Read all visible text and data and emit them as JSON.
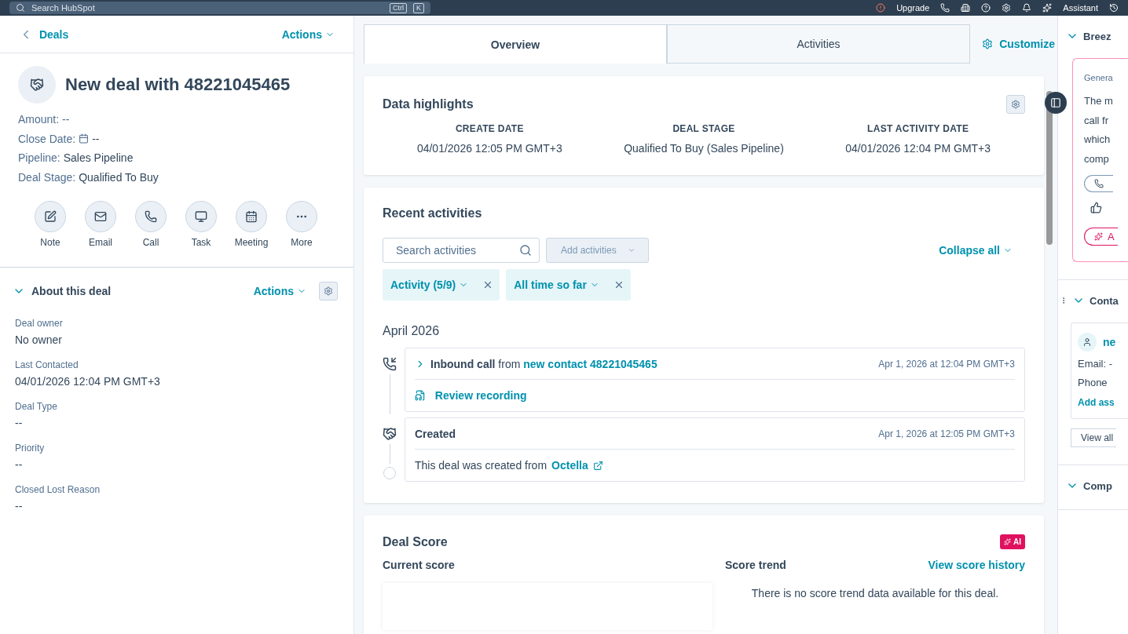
{
  "topbar": {
    "search_placeholder": "Search HubSpot",
    "shortcut_keys": [
      "Ctrl",
      "K"
    ],
    "upgrade": "Upgrade",
    "assistant": "Assistant"
  },
  "left": {
    "back": "Deals",
    "actions": "Actions",
    "title": "New deal with 48221045465",
    "properties": [
      {
        "text": "Amount: --",
        "kind": "text"
      },
      {
        "label": "Close Date:",
        "value": "--",
        "kind": "date"
      },
      {
        "label": "Pipeline:",
        "value": "Sales Pipeline",
        "kind": "field"
      },
      {
        "label": "Deal Stage:",
        "value": "Qualified To Buy",
        "kind": "field"
      }
    ],
    "quick_actions": [
      {
        "label": "Note",
        "kind": "note"
      },
      {
        "label": "Email",
        "kind": "email"
      },
      {
        "label": "Call",
        "kind": "call"
      },
      {
        "label": "Task",
        "kind": "task"
      },
      {
        "label": "Meeting",
        "kind": "meeting"
      },
      {
        "label": "More",
        "kind": "more"
      }
    ],
    "about": {
      "title": "About this deal",
      "actions": "Actions",
      "expanded": true,
      "fields": [
        {
          "label": "Deal owner",
          "value": "No owner"
        },
        {
          "label": "Last Contacted",
          "value": "04/01/2026 12:04 PM GMT+3"
        },
        {
          "label": "Deal Type",
          "value": "--"
        },
        {
          "label": "Priority",
          "value": "--"
        },
        {
          "label": "Closed Lost Reason",
          "value": "--"
        }
      ]
    }
  },
  "middle": {
    "tabs": [
      {
        "label": "Overview",
        "selected": true
      },
      {
        "label": "Activities",
        "selected": false
      }
    ],
    "customize": "Customize",
    "highlights": {
      "title": "Data highlights",
      "columns": [
        {
          "label": "CREATE DATE",
          "value": "04/01/2026 12:05 PM GMT+3"
        },
        {
          "label": "DEAL STAGE",
          "value": "Qualified To Buy (Sales Pipeline)"
        },
        {
          "label": "LAST ACTIVITY DATE",
          "value": "04/01/2026 12:04 PM GMT+3"
        }
      ]
    },
    "recent": {
      "title": "Recent activities",
      "search_placeholder": "Search activities",
      "add_button": "Add activities",
      "collapse": "Collapse all",
      "filters": [
        {
          "label": "Activity (5/9)"
        },
        {
          "label": "All time so far"
        }
      ],
      "month": "April 2026",
      "items": [
        {
          "kind": "call",
          "title": "Inbound call",
          "middle": "from",
          "link": "new contact 48221045465",
          "time": "Apr 1, 2026 at 12:04 PM GMT+3",
          "action": "Review recording"
        },
        {
          "kind": "created",
          "title": "Created",
          "body": "This deal was created from",
          "link": "Octella",
          "time": "Apr 1, 2026 at 12:05 PM GMT+3"
        }
      ]
    },
    "score": {
      "title": "Deal Score",
      "badge": "AI",
      "current": "Current score",
      "trend": "Score trend",
      "history": "View score history",
      "empty": "There is no score trend data available for this deal."
    }
  },
  "right": {
    "sections": [
      {
        "title": "Breez",
        "expanded": true,
        "kind": "summary",
        "caption": "Genera",
        "lines": [
          "The m",
          "call fr",
          "which",
          "comp"
        ],
        "ask": "A"
      },
      {
        "title": "Conta",
        "expanded": true,
        "kind": "contacts",
        "name": "ne",
        "email": "Email: -",
        "phone": "Phone",
        "add": "Add ass",
        "view_all": "View all"
      },
      {
        "title": "Comp",
        "expanded": true,
        "kind": "empty"
      }
    ]
  }
}
